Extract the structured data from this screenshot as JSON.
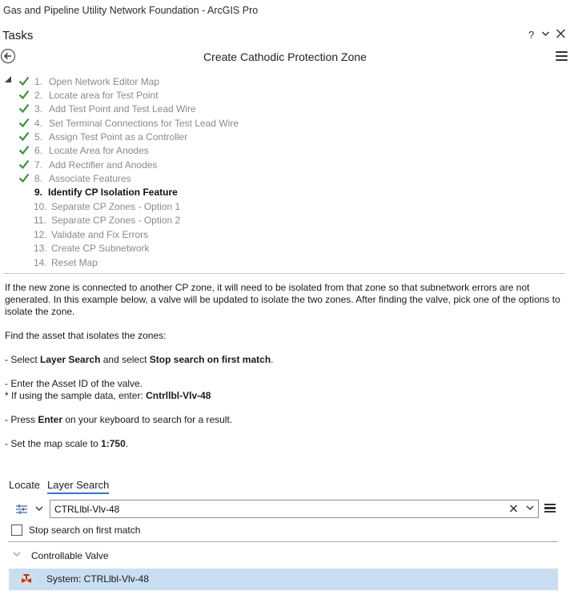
{
  "app": {
    "window_title": "Gas and Pipeline Utility Network Foundation - ArcGIS Pro"
  },
  "pane": {
    "title": "Tasks",
    "help_label": "?",
    "options_label": "⌄",
    "close_label": "✕"
  },
  "task": {
    "title": "Create Cathodic Protection Zone"
  },
  "steps": [
    {
      "num": "1.",
      "label": "Open Network Editor Map",
      "done": true
    },
    {
      "num": "2.",
      "label": "Locate area for Test Point",
      "done": true
    },
    {
      "num": "3.",
      "label": "Add Test Point and Test Lead Wire",
      "done": true
    },
    {
      "num": "4.",
      "label": "Set Terminal Connections for Test Lead Wire",
      "done": true
    },
    {
      "num": "5.",
      "label": "Assign Test Point as a Controller",
      "done": true
    },
    {
      "num": "6.",
      "label": "Locate Area for Anodes",
      "done": true
    },
    {
      "num": "7.",
      "label": "Add Rectifier and Anodes",
      "done": true
    },
    {
      "num": "8.",
      "label": "Associate Features",
      "done": true
    },
    {
      "num": "9.",
      "label": "Identify CP Isolation Feature",
      "done": false,
      "current": true
    },
    {
      "num": "10.",
      "label": "Separate CP Zones - Option 1",
      "done": false
    },
    {
      "num": "11.",
      "label": "Separate CP Zones - Option 2",
      "done": false
    },
    {
      "num": "12.",
      "label": "Validate and Fix Errors",
      "done": false
    },
    {
      "num": "13.",
      "label": "Create CP Subnetwork",
      "done": false
    },
    {
      "num": "14.",
      "label": "Reset Map",
      "done": false
    }
  ],
  "instructions": {
    "intro": "If the new zone is connected to another CP zone, it will need to be isolated from that zone so that subnetwork errors are not generated. In this example below, a valve will be updated to isolate the two zones. After finding the valve, pick one of the options to isolate the zone.",
    "find": "Find the asset that isolates the zones:",
    "b1_pre": "- Select ",
    "b1_bold1": "Layer Search",
    "b1_mid": " and select ",
    "b1_bold2": "Stop search on first match",
    "b1_post": ".",
    "b2_line1": "- Enter the Asset ID of the valve.",
    "b2_line2_pre": "* If using the sample data, enter: ",
    "b2_line2_bold": "Cntrllbl-Vlv-48",
    "b3_pre": "- Press ",
    "b3_bold": "Enter",
    "b3_post": " on your keyboard to search for a result.",
    "b4_pre": "- Set the map scale to ",
    "b4_bold": "1:750",
    "b4_post": "."
  },
  "tabs": {
    "locate": "Locate",
    "layer_search": "Layer Search",
    "active": "layer_search"
  },
  "search": {
    "value": "CTRLlbl-Vlv-48",
    "clear_label": "✕",
    "dropdown_label": "⌄"
  },
  "option": {
    "stop_search_label": "Stop search on first match",
    "checked": false
  },
  "results": {
    "group_label": "Controllable Valve",
    "item_label": "System: CTRLlbl-Vlv-48"
  },
  "colors": {
    "check_green": "#3a8f3a",
    "selection_blue": "#c9def1",
    "tab_underline": "#2b7ac9",
    "valve_red": "#c0392b"
  }
}
